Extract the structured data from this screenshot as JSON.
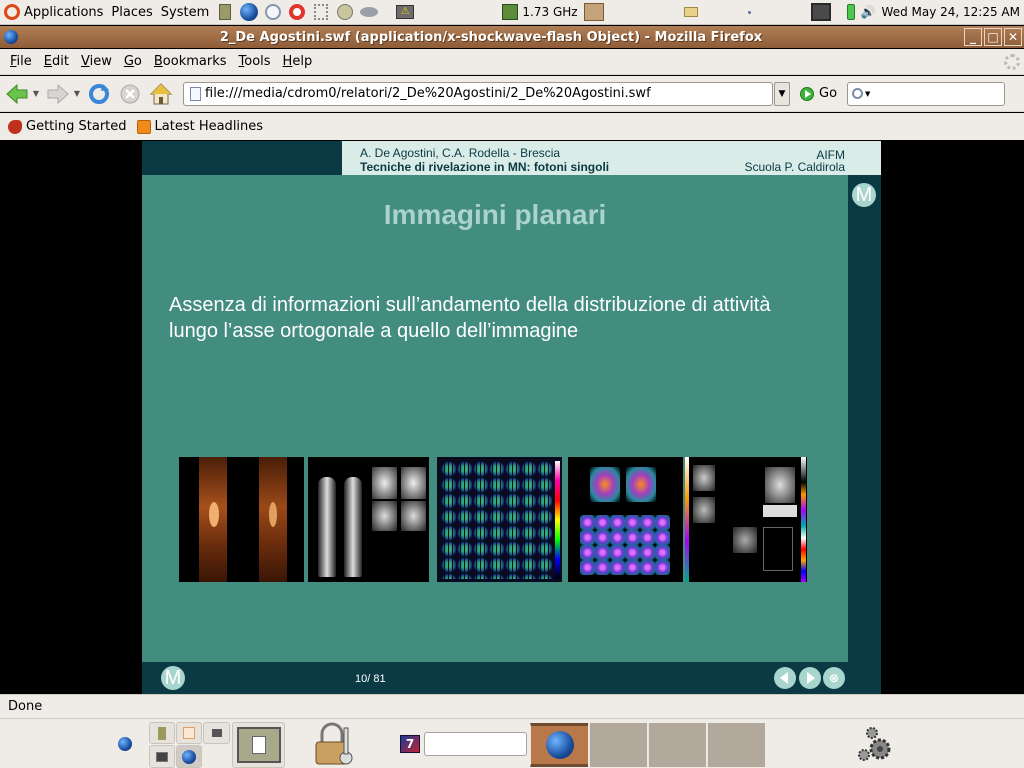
{
  "top_panel": {
    "menus": [
      "Applications",
      "Places",
      "System"
    ],
    "launchers": [
      "file-cabinet-icon",
      "firefox-globe-icon",
      "mail-clock-icon",
      "help-lifebuoy-icon",
      "network-icon",
      "cd-icon",
      "disk-mount-icon",
      "warning-monitor-icon"
    ],
    "cpu_freq": "1.73 GHz",
    "clock": "Wed May 24, 12:25 AM"
  },
  "window": {
    "title": "2_De Agostini.swf (application/x-shockwave-flash Object) - Mozilla Firefox",
    "buttons": {
      "minimize": "_",
      "maximize": "□",
      "close": "✕"
    }
  },
  "menu_bar": {
    "items": [
      {
        "accel": "F",
        "rest": "ile"
      },
      {
        "accel": "E",
        "rest": "dit"
      },
      {
        "accel": "V",
        "rest": "iew"
      },
      {
        "accel": "G",
        "rest": "o"
      },
      {
        "accel": "B",
        "rest": "ookmarks"
      },
      {
        "accel": "T",
        "rest": "ools"
      },
      {
        "accel": "H",
        "rest": "elp"
      }
    ]
  },
  "nav_bar": {
    "url": "file:///media/cdrom0/relatori/2_De%20Agostini/2_De%20Agostini.swf",
    "go_label": "Go",
    "search_placeholder": ""
  },
  "bookmarks": [
    {
      "label": "Getting Started",
      "icon": "firefox-icon"
    },
    {
      "label": "Latest Headlines",
      "icon": "rss-icon"
    }
  ],
  "slide": {
    "header": {
      "authors": "A. De Agostini, C.A. Rodella - Brescia",
      "course": "Tecniche di rivelazione in MN: fotoni singoli",
      "org": "AIFM",
      "school": "Scuola P. Caldirola"
    },
    "title": "Immagini planari",
    "body_line1": "Assenza di informazioni sull’andamento della distribuzione di attività",
    "body_line2": "lungo l’asse ortogonale a quello dell’immagine",
    "menu_button": "M",
    "page_counter": "10/ 81",
    "colors": {
      "dark": "#0b3a45",
      "body": "#428c80",
      "header": "#d9ece7",
      "title": "#a9d3cb",
      "button": "#a8d6cd"
    }
  },
  "status_bar": {
    "text": "Done"
  },
  "bottom_panel": {
    "tasks": 4,
    "active_task": 0
  }
}
